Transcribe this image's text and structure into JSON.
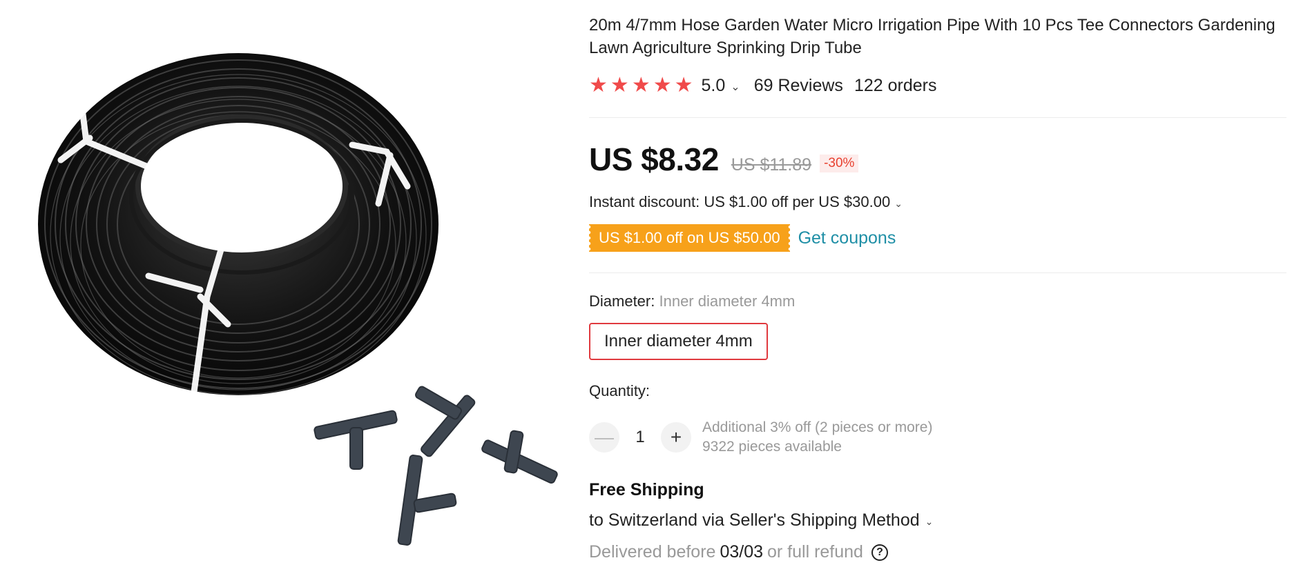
{
  "product": {
    "title": "20m 4/7mm Hose Garden Water Micro Irrigation Pipe With 10 Pcs Tee Connectors Gardening Lawn Agriculture Sprinking Drip Tube",
    "image_icon": "hose-coil-with-tee-connectors-image"
  },
  "rating": {
    "stars": 5,
    "value": "5.0",
    "reviews": "69 Reviews",
    "orders": "122 orders",
    "star_color": "#f04a4a"
  },
  "price": {
    "current": "US $8.32",
    "original": "US $11.89",
    "discount": "-30%"
  },
  "discount": {
    "instant": "Instant discount: US $1.00 off per US $30.00",
    "coupon_tag": "US $1.00 off on US $50.00",
    "get_coupons": "Get coupons",
    "coupon_color": "#f7a11a",
    "link_color": "#1f8fa6"
  },
  "variant": {
    "label": "Diameter:",
    "selected": "Inner diameter 4mm",
    "options": [
      "Inner diameter 4mm"
    ]
  },
  "quantity": {
    "label": "Quantity:",
    "value": "1",
    "minus_icon": "minus-icon",
    "plus_icon": "plus-icon",
    "bulk_note": "Additional 3% off (2 pieces or more)",
    "available": "9322 pieces available"
  },
  "shipping": {
    "title": "Free Shipping",
    "to": "to Switzerland via Seller's Shipping Method",
    "delivered_prefix": "Delivered before",
    "delivered_date": "03/03",
    "delivered_suffix": "or full refund"
  }
}
